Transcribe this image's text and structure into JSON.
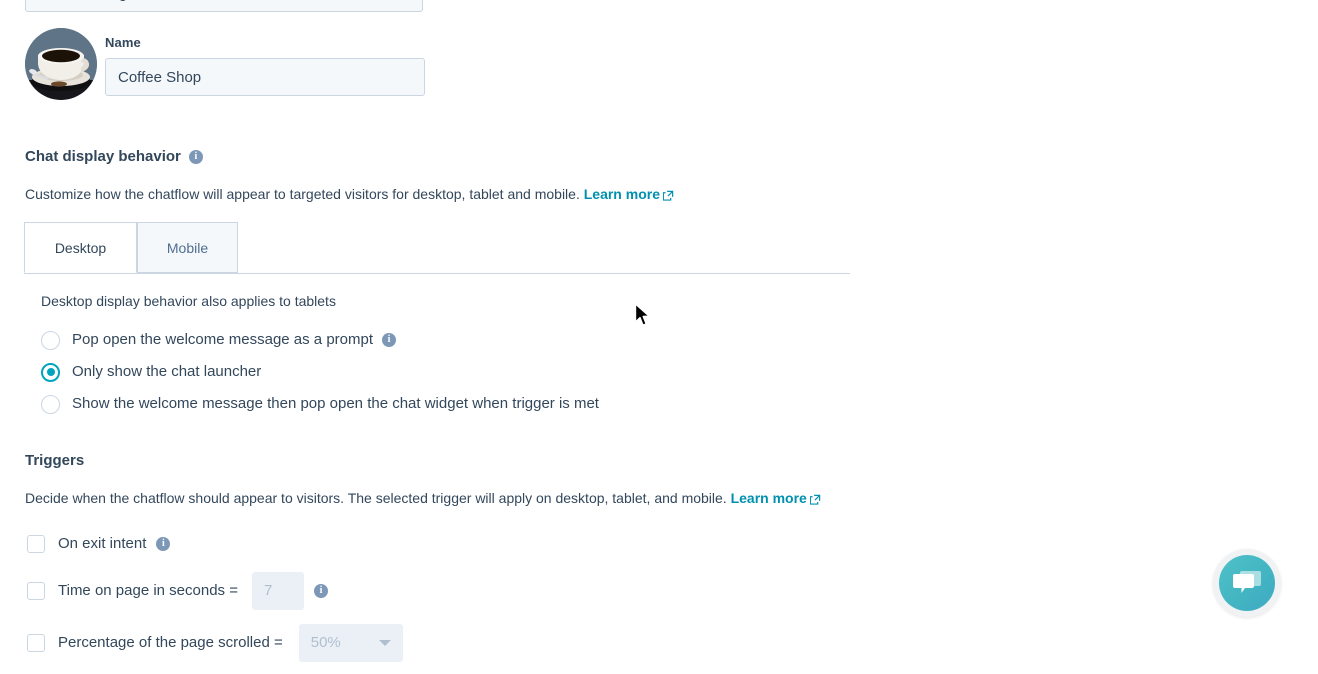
{
  "form": {
    "truncated_field_value": "Chat heading",
    "avatar_alt": "coffee-cup-avatar",
    "name_label": "Name",
    "name_value": "Coffee Shop"
  },
  "chat_display": {
    "title": "Chat display behavior",
    "info_glyph": "i",
    "description": "Customize how the chatflow will appear to targeted visitors for desktop, tablet and mobile.",
    "learn_more": "Learn more",
    "tabs": [
      {
        "label": "Desktop",
        "active": true
      },
      {
        "label": "Mobile",
        "active": false
      }
    ],
    "note": "Desktop display behavior also applies to tablets",
    "options": [
      {
        "label": "Pop open the welcome message as a prompt",
        "checked": false,
        "has_info": true
      },
      {
        "label": "Only show the chat launcher",
        "checked": true,
        "has_info": false
      },
      {
        "label": "Show the welcome message then pop open the chat widget when trigger is met",
        "checked": false,
        "has_info": false
      }
    ]
  },
  "triggers": {
    "title": "Triggers",
    "description": "Decide when the chatflow should appear to visitors. The selected trigger will apply on desktop, tablet, and mobile.",
    "learn_more": "Learn more",
    "items": [
      {
        "label": "On exit intent",
        "checked": false,
        "has_info": true
      },
      {
        "label": "Time on page in seconds =",
        "checked": false,
        "has_info": true,
        "value": "7"
      },
      {
        "label": "Percentage of the page scrolled =",
        "checked": false,
        "has_info": false,
        "value": "50%"
      }
    ]
  },
  "launcher": {
    "name": "chat-launcher",
    "color": "#45b8c4"
  },
  "colors": {
    "accent": "#00a4bd",
    "link": "#0091ae",
    "text": "#33475b",
    "border": "#cbd6e2",
    "input_bg": "#f5f8fa",
    "disabled_bg": "#eaf0f6"
  }
}
